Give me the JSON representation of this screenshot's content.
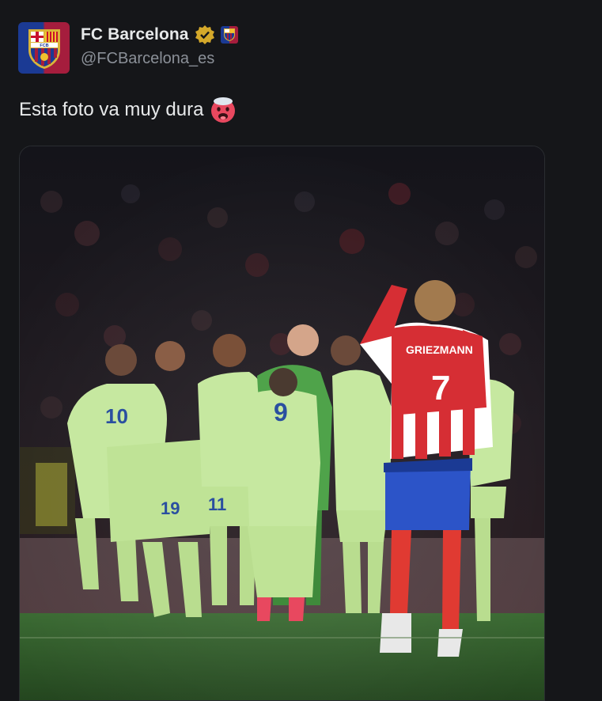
{
  "author": {
    "name": "FC Barcelona",
    "handle": "@FCBarcelona_es",
    "avatar_icon": "fc-barcelona-crest-icon",
    "verified_icon": "gold-verified-badge-icon",
    "affiliate_icon": "fc-barcelona-affiliate-badge-icon",
    "avatar_text": "FCB"
  },
  "post": {
    "text": "Esta foto va muy dura",
    "emoji_icon": "hot-face-emoji-icon"
  },
  "media": {
    "description_icon": "team-huddle-photo",
    "jersey_numbers": {
      "center_back": "9",
      "left_short": "19",
      "left_player": "10",
      "short_mid": "11",
      "opponent": "7"
    },
    "opponent_name": "GRIEZMANN"
  },
  "colors": {
    "background": "#151619",
    "text_primary": "#e7e9ea",
    "text_secondary": "#8b9098",
    "verified_gold": "#d4a82a",
    "barca_blue": "#1b3a94",
    "barca_red": "#a51d3d",
    "kit_green": "#c6e8a0",
    "pitch": "#2f5a2a"
  }
}
